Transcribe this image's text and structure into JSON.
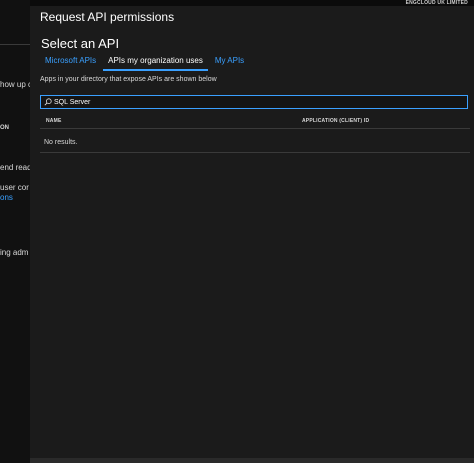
{
  "background_page": {
    "fragments": [
      {
        "text": "how up c",
        "style": "normal"
      },
      {
        "text": "ON",
        "style": "bold"
      },
      {
        "text": "end read c",
        "style": "normal"
      },
      {
        "text": "user cor",
        "style": "normal"
      },
      {
        "text": "ons",
        "style": "link"
      },
      {
        "text": "ing adm",
        "style": "normal"
      }
    ]
  },
  "tenant": "ENGCLOUD UK LIMITED",
  "blade": {
    "title": "Request API permissions",
    "section_title": "Select an API",
    "tabs": [
      {
        "label": "Microsoft APIs",
        "active": false
      },
      {
        "label": "APIs my organization uses",
        "active": true
      },
      {
        "label": "My APIs",
        "active": false
      }
    ],
    "description": "Apps in your directory that expose APIs are shown below",
    "search": {
      "value": "SQL Server",
      "placeholder": ""
    },
    "table": {
      "columns": [
        "NAME",
        "APPLICATION (CLIENT) ID"
      ],
      "empty_message": "No results."
    }
  },
  "colors": {
    "accent": "#3aa0ff",
    "background": "#1b1b1b",
    "text": "#e6e6e6"
  }
}
